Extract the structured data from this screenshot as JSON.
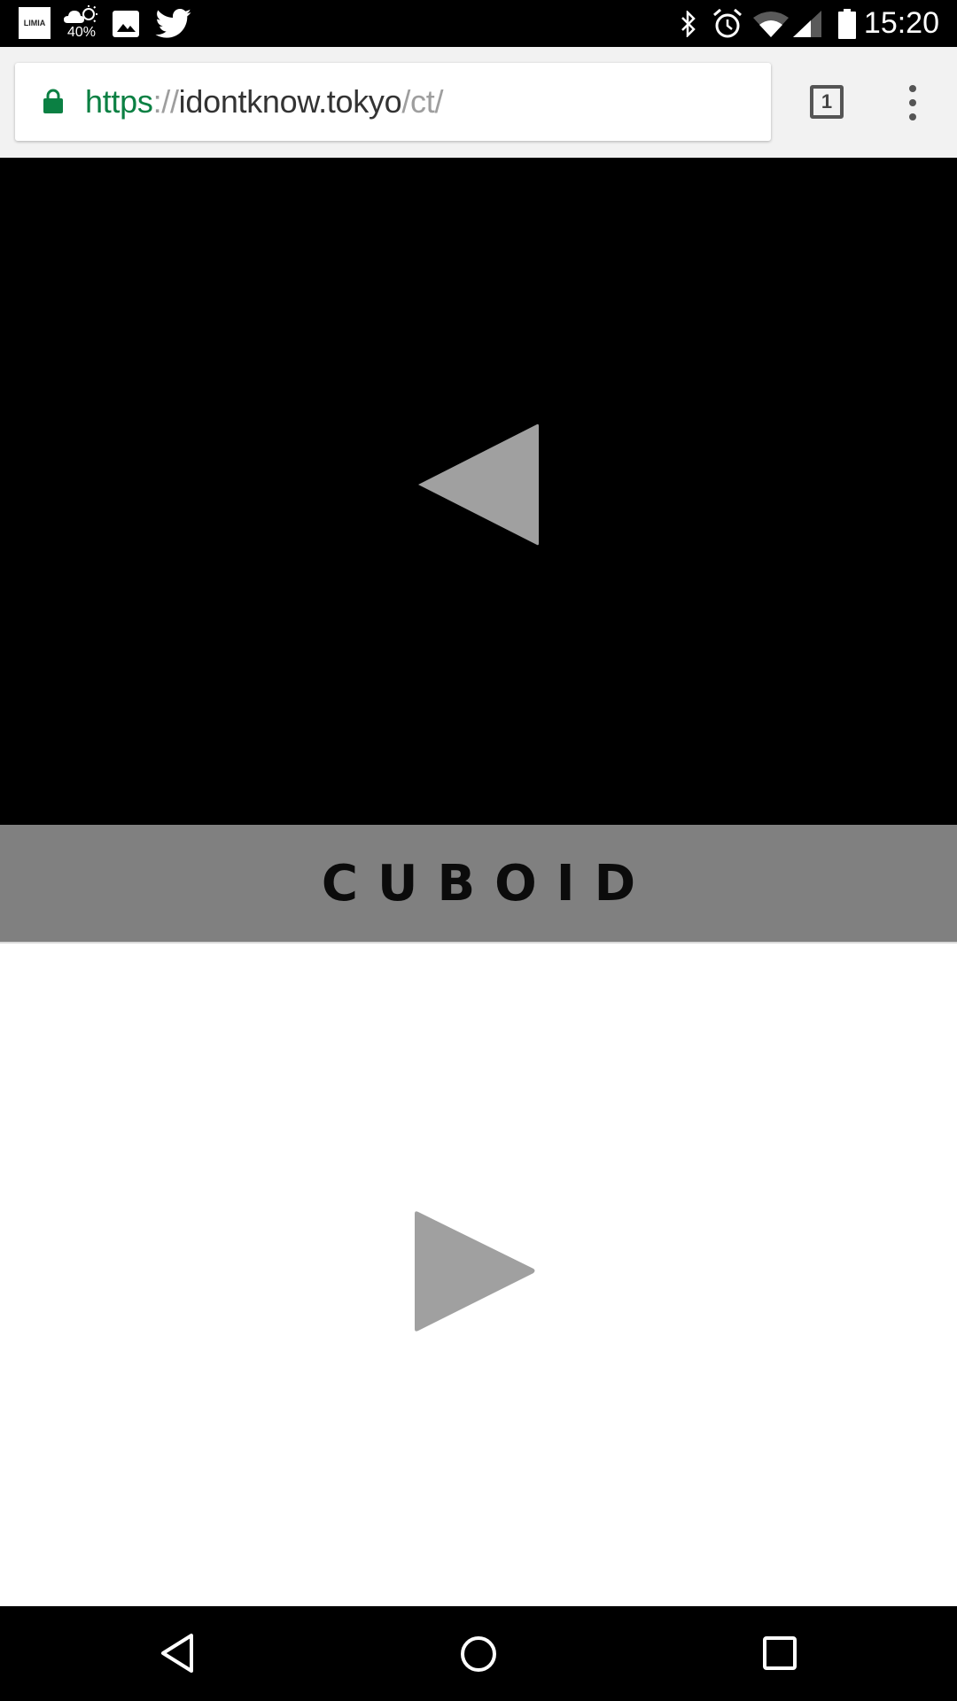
{
  "status_bar": {
    "notifications": [
      {
        "icon": "limia-app-icon",
        "label": "LIMIA"
      },
      {
        "icon": "weather-icon",
        "label": "40%"
      },
      {
        "icon": "gallery-icon"
      },
      {
        "icon": "twitter-icon"
      }
    ],
    "system_icons": [
      "bluetooth-icon",
      "alarm-icon",
      "wifi-icon",
      "cell-signal-icon",
      "battery-icon"
    ],
    "time": "15:20"
  },
  "browser": {
    "url": {
      "scheme": "https",
      "separator": "://",
      "host": "idontknow.tokyo",
      "path": "/ct/"
    },
    "secure": true,
    "tab_count": "1",
    "colors": {
      "secure_green": "#0b8043",
      "toolbar_bg": "#f2f2f2"
    }
  },
  "page": {
    "top_panel": {
      "button": "previous-arrow",
      "bg_color": "#000000",
      "arrow_color": "#a0a0a0"
    },
    "title": "CUBOID",
    "title_band_color": "#808080",
    "bottom_panel": {
      "button": "next-arrow",
      "bg_color": "#ffffff",
      "arrow_color": "#a0a0a0"
    }
  },
  "nav_bar": {
    "buttons": [
      "back",
      "home",
      "recents"
    ]
  }
}
